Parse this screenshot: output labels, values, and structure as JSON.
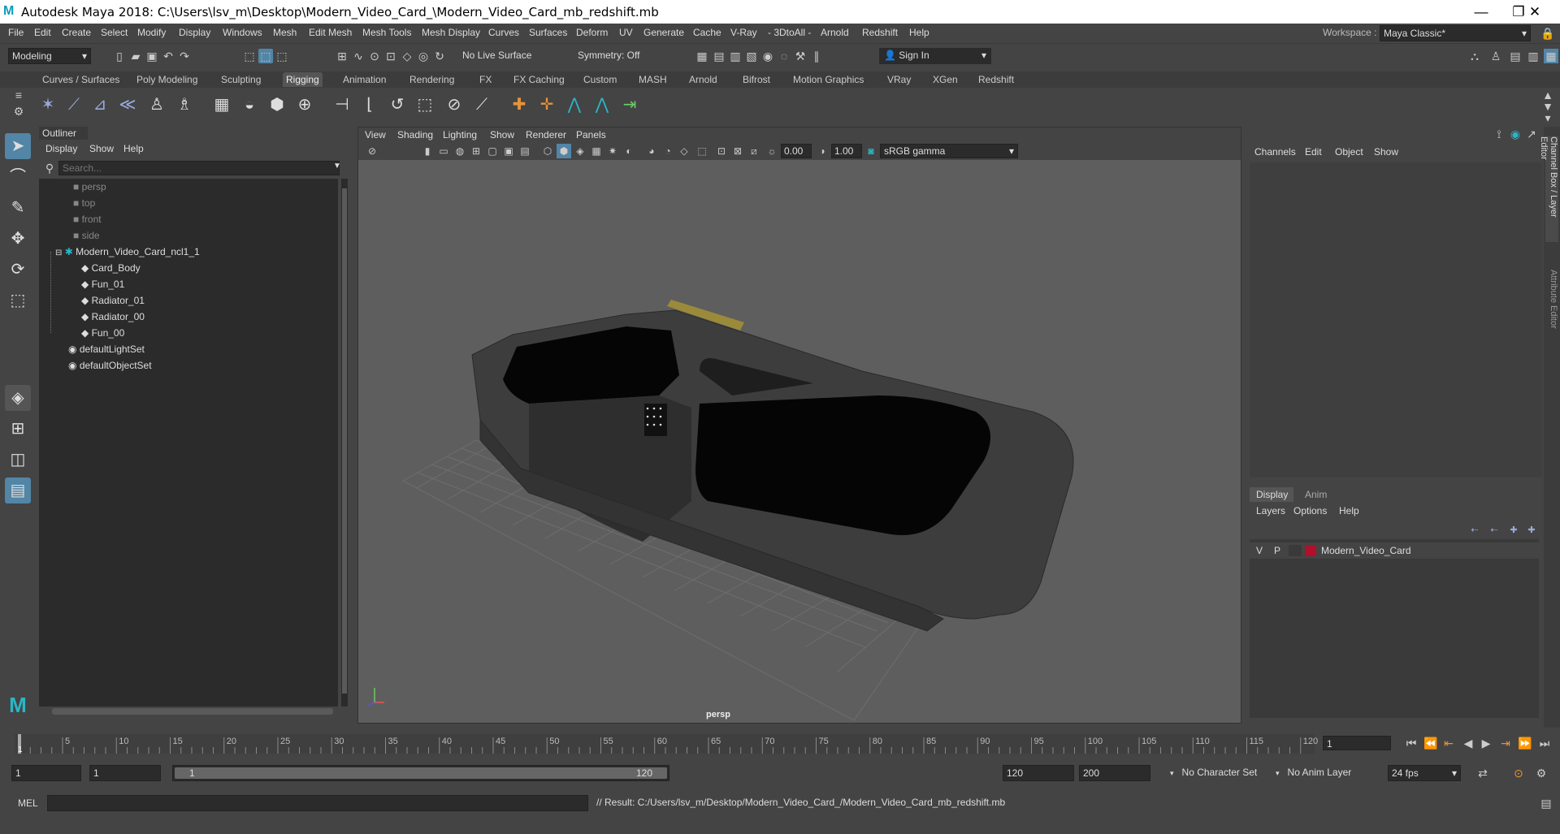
{
  "titlebar": {
    "logo": "M",
    "title": "Autodesk Maya 2018: C:\\Users\\lsv_m\\Desktop\\Modern_Video_Card_\\Modern_Video_Card_mb_redshift.mb",
    "minimize": "—",
    "restore": "❐",
    "close": "✕"
  },
  "menubar": {
    "items": [
      "File",
      "Edit",
      "Create",
      "Select",
      "Modify",
      "Display",
      "Windows",
      "Mesh",
      "Edit Mesh",
      "Mesh Tools",
      "Mesh Display",
      "Curves",
      "Surfaces",
      "Deform",
      "UV",
      "Generate",
      "Cache",
      "V-Ray",
      "- 3DtoAll -",
      "Arnold",
      "Redshift",
      "Help"
    ],
    "workspace_label": "Workspace :",
    "workspace_value": "Maya Classic*"
  },
  "statusline": {
    "mode": "Modeling",
    "live_surface": "No Live Surface",
    "symmetry": "Symmetry: Off",
    "sign_in": "Sign In"
  },
  "shelf": {
    "tabs": [
      "Curves / Surfaces",
      "Poly Modeling",
      "Sculpting",
      "Rigging",
      "Animation",
      "Rendering",
      "FX",
      "FX Caching",
      "Custom",
      "MASH",
      "Arnold",
      "Bifrost",
      "Motion Graphics",
      "VRay",
      "XGen",
      "Redshift"
    ],
    "active_tab": "Rigging"
  },
  "outliner": {
    "title": "Outliner",
    "menu": [
      "Display",
      "Show",
      "Help"
    ],
    "search_placeholder": "Search...",
    "cameras": [
      "persp",
      "top",
      "front",
      "side"
    ],
    "group": "Modern_Video_Card_ncl1_1",
    "children": [
      "Card_Body",
      "Fun_01",
      "Radiator_01",
      "Radiator_00",
      "Fun_00"
    ],
    "sets": [
      "defaultLightSet",
      "defaultObjectSet"
    ]
  },
  "viewport": {
    "menu": [
      "View",
      "Shading",
      "Lighting",
      "Show",
      "Renderer",
      "Panels"
    ],
    "exposure": "0.00",
    "gamma": "1.00",
    "colorspace": "sRGB gamma",
    "camera_label": "persp"
  },
  "channelbox": {
    "menu": [
      "Channels",
      "Edit",
      "Object",
      "Show"
    ],
    "layer_tabs": [
      "Display",
      "Anim"
    ],
    "active_layer_tab": "Display",
    "layer_menu": [
      "Layers",
      "Options",
      "Help"
    ],
    "layer": {
      "v": "V",
      "p": "P",
      "name": "Modern_Video_Card",
      "color": "#b0102a"
    }
  },
  "sidetabs": [
    "Channel Box / Layer Editor",
    "Attribute Editor"
  ],
  "timeline": {
    "ticks": [
      5,
      10,
      15,
      20,
      25,
      30,
      35,
      40,
      45,
      50,
      55,
      60,
      65,
      70,
      75,
      80,
      85,
      90,
      95,
      100,
      105,
      110,
      115,
      120
    ],
    "current_frame": "1",
    "marker": "1"
  },
  "rangebar": {
    "start": "1",
    "inner_start": "1",
    "slider_start": "1",
    "slider_end": "120",
    "end": "120",
    "max_end": "200",
    "char_set": "No Character Set",
    "anim_layer": "No Anim Layer",
    "fps": "24 fps"
  },
  "cmdline": {
    "label": "MEL",
    "result": "// Result: C:/Users/lsv_m/Desktop/Modern_Video_Card_/Modern_Video_Card_mb_redshift.mb"
  },
  "colors": {
    "bg": "#444444",
    "viewport": "#5e5e5e",
    "highlight": "#5285a6",
    "accent": "#0d9ab8"
  }
}
